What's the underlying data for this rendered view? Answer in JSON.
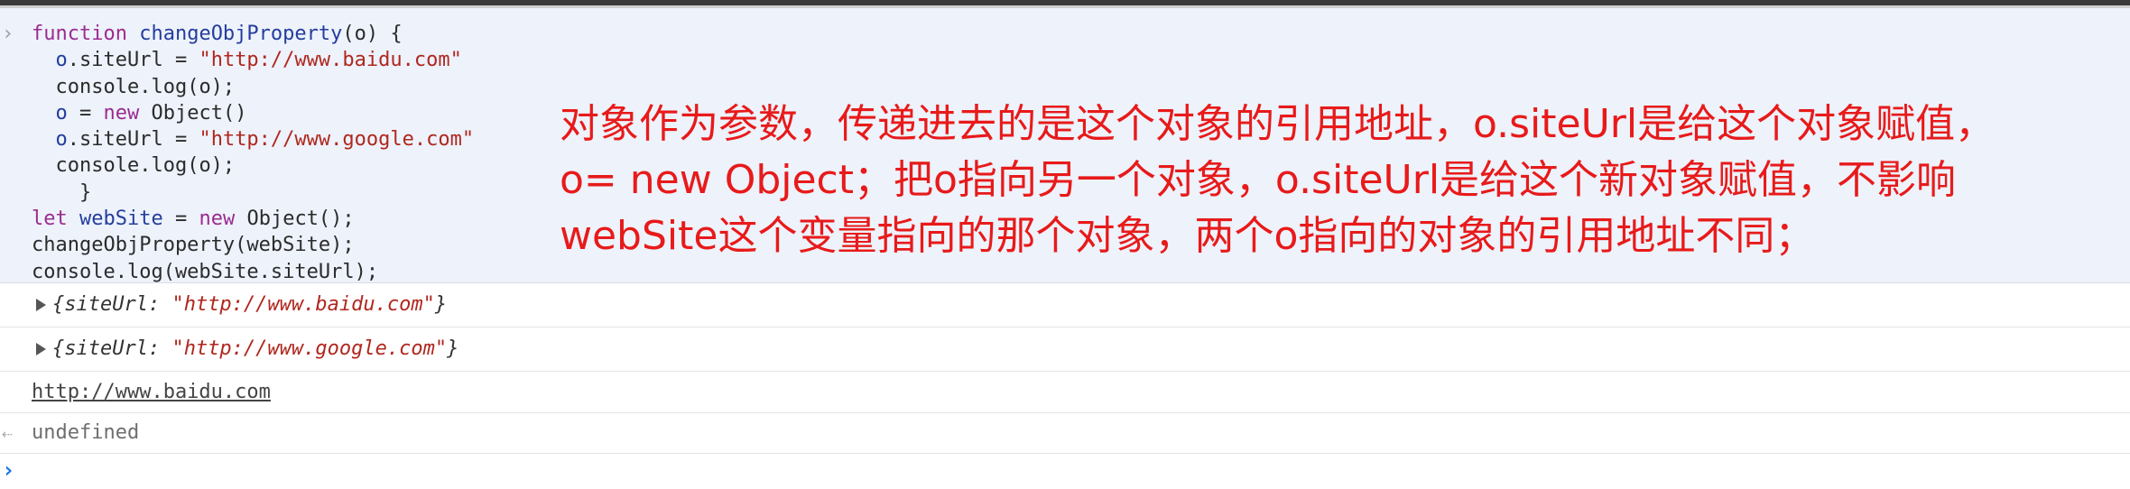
{
  "console_input": {
    "prompt_symbol": "›",
    "lines": [
      {
        "indent": "",
        "parts": [
          {
            "t": "kw",
            "v": "function"
          },
          {
            "t": "plain",
            "v": " "
          },
          {
            "t": "fn",
            "v": "changeObjProperty"
          },
          {
            "t": "plain",
            "v": "(o) {"
          }
        ]
      },
      {
        "indent": "  ",
        "parts": [
          {
            "t": "var",
            "v": "o"
          },
          {
            "t": "plain",
            "v": ".siteUrl = "
          },
          {
            "t": "str",
            "v": "\"http://www.baidu.com\""
          }
        ]
      },
      {
        "indent": "  ",
        "parts": [
          {
            "t": "plain",
            "v": "console.log(o);"
          }
        ]
      },
      {
        "indent": "  ",
        "parts": [
          {
            "t": "var",
            "v": "o"
          },
          {
            "t": "plain",
            "v": " = "
          },
          {
            "t": "kw",
            "v": "new"
          },
          {
            "t": "plain",
            "v": " Object()"
          }
        ]
      },
      {
        "indent": "  ",
        "parts": [
          {
            "t": "var",
            "v": "o"
          },
          {
            "t": "plain",
            "v": ".siteUrl = "
          },
          {
            "t": "str",
            "v": "\"http://www.google.com\""
          }
        ]
      },
      {
        "indent": "  ",
        "parts": [
          {
            "t": "plain",
            "v": "console.log(o);"
          }
        ]
      },
      {
        "indent": "    ",
        "parts": [
          {
            "t": "plain",
            "v": "}"
          }
        ]
      },
      {
        "indent": "",
        "parts": [
          {
            "t": "kw",
            "v": "let"
          },
          {
            "t": "plain",
            "v": " "
          },
          {
            "t": "var",
            "v": "webSite"
          },
          {
            "t": "plain",
            "v": " = "
          },
          {
            "t": "kw",
            "v": "new"
          },
          {
            "t": "plain",
            "v": " Object();"
          }
        ]
      },
      {
        "indent": "",
        "parts": [
          {
            "t": "plain",
            "v": "changeObjProperty(webSite);"
          }
        ]
      },
      {
        "indent": "",
        "parts": [
          {
            "t": "plain",
            "v": "console.log(webSite.siteUrl);"
          }
        ]
      }
    ]
  },
  "annotation": {
    "lines": [
      "对象作为参数，传递进去的是这个对象的引用地址，o.siteUrl是给这个对象赋值，",
      "o= new Object；把o指向另一个对象，o.siteUrl是给这个新对象赋值，不影响",
      "webSite这个变量指向的那个对象，两个o指向的对象的引用地址不同；"
    ],
    "color": "#e81a1a"
  },
  "output": {
    "log1": {
      "prefix": "{siteUrl: ",
      "value": "\"http://www.baidu.com\"",
      "suffix": "}"
    },
    "log2": {
      "prefix": "{siteUrl: ",
      "value": "\"http://www.google.com\"",
      "suffix": "}"
    },
    "log3": "http://www.baidu.com",
    "return_symbol": "⇠",
    "return_value": "undefined"
  },
  "new_prompt_symbol": "›",
  "colors": {
    "keyword": "#9c2b8f",
    "string": "#b0271e",
    "identifier": "#243d9c",
    "prompt": "#1a73e8",
    "input_background": "#edf2fb"
  }
}
